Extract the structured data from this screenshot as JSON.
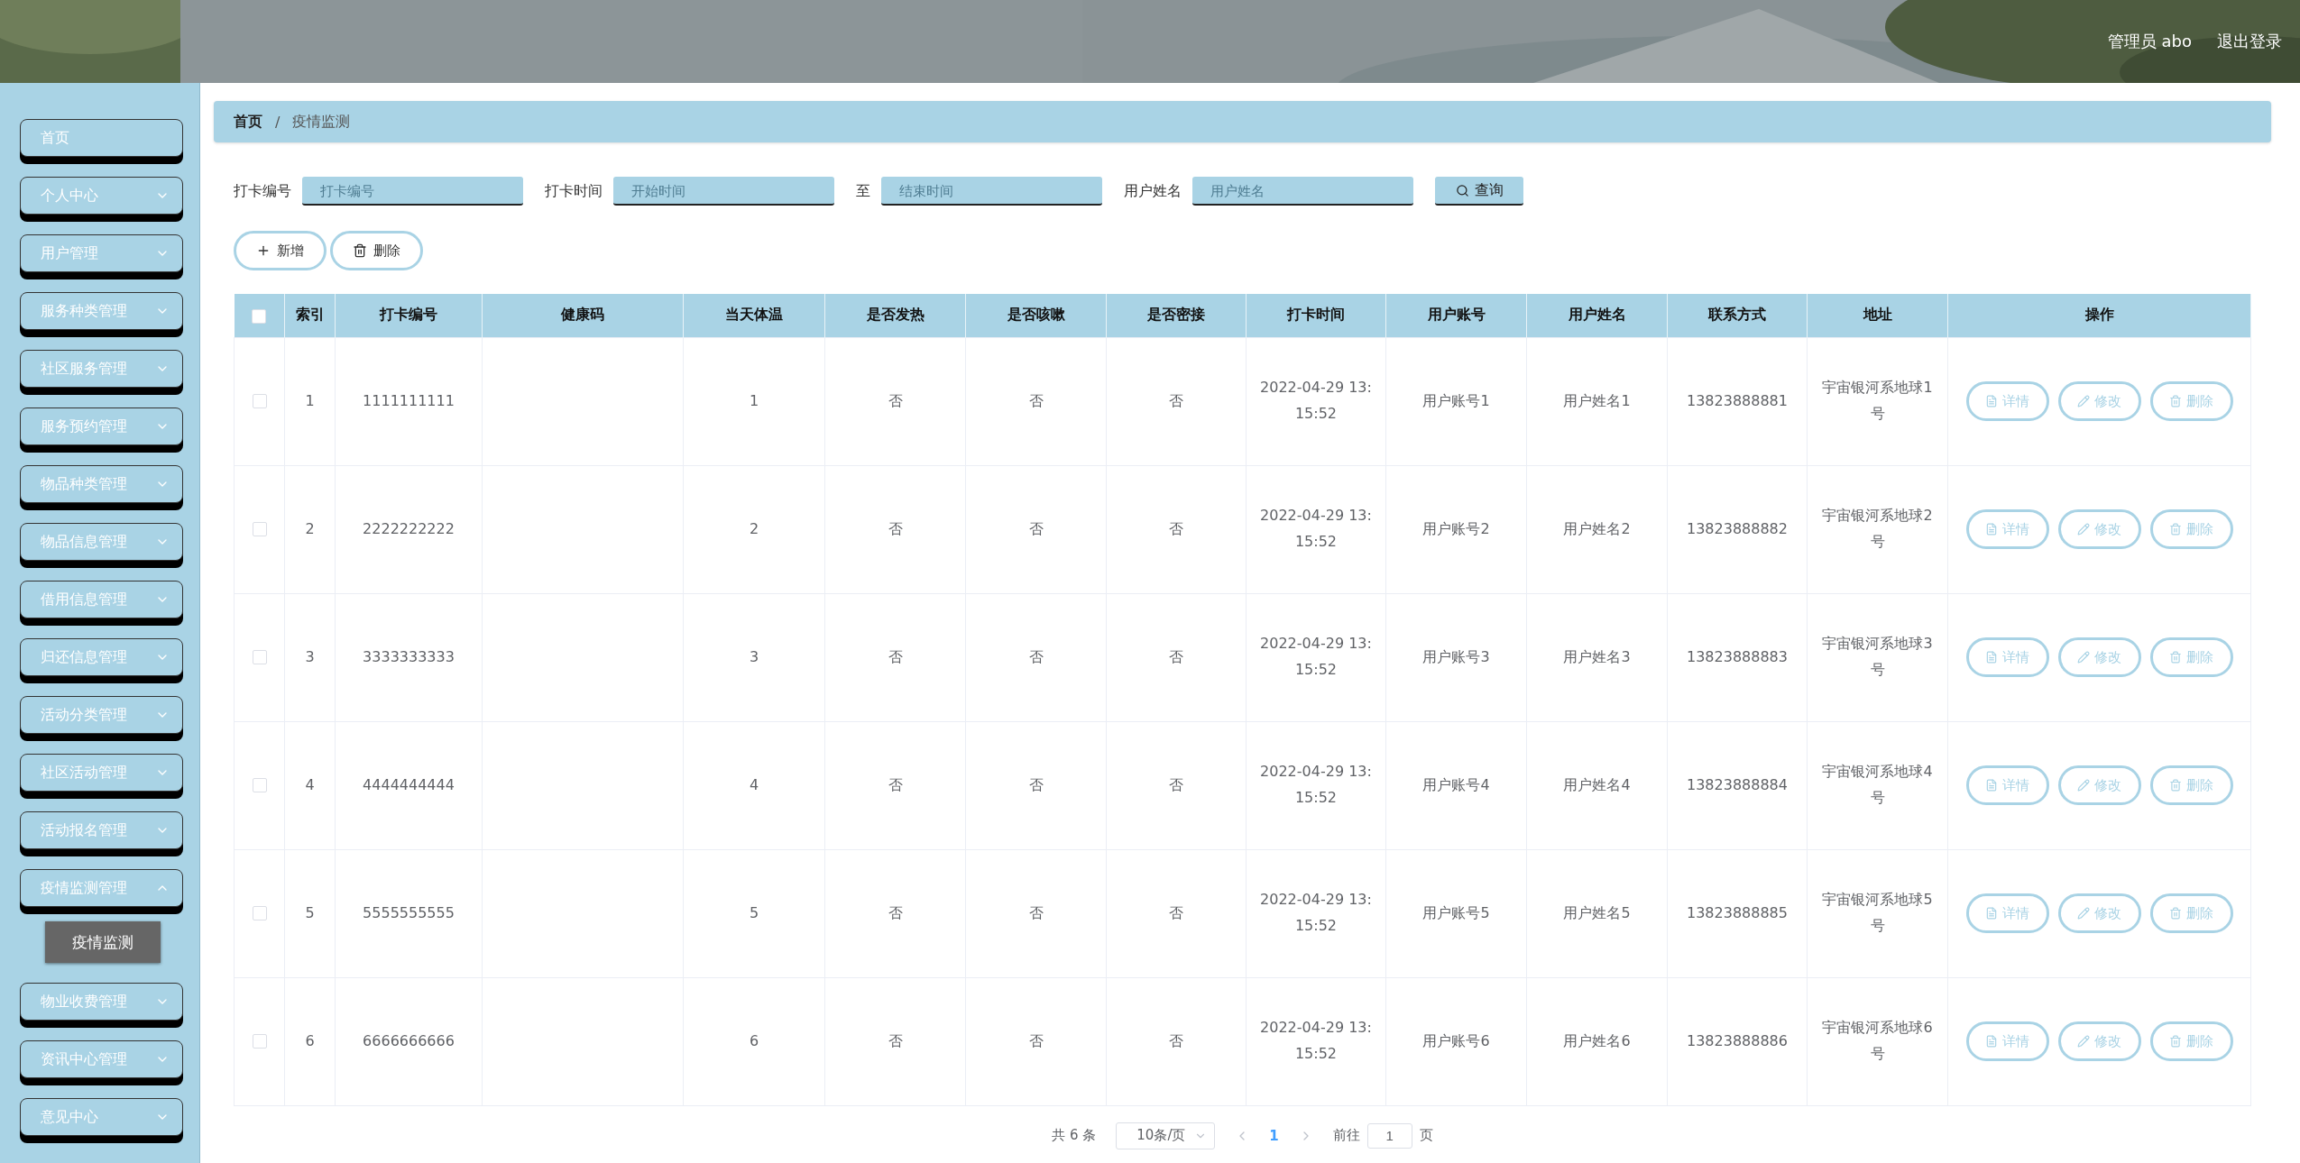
{
  "header": {
    "user": "管理员 abo",
    "logout": "退出登录"
  },
  "sidebar": {
    "items": [
      {
        "label": "首页",
        "kind": "link"
      },
      {
        "label": "个人中心",
        "kind": "menu",
        "expanded": false
      },
      {
        "label": "用户管理",
        "kind": "menu",
        "expanded": false
      },
      {
        "label": "服务种类管理",
        "kind": "menu",
        "expanded": false
      },
      {
        "label": "社区服务管理",
        "kind": "menu",
        "expanded": false
      },
      {
        "label": "服务预约管理",
        "kind": "menu",
        "expanded": false
      },
      {
        "label": "物品种类管理",
        "kind": "menu",
        "expanded": false
      },
      {
        "label": "物品信息管理",
        "kind": "menu",
        "expanded": false
      },
      {
        "label": "借用信息管理",
        "kind": "menu",
        "expanded": false
      },
      {
        "label": "归还信息管理",
        "kind": "menu",
        "expanded": false
      },
      {
        "label": "活动分类管理",
        "kind": "menu",
        "expanded": false
      },
      {
        "label": "社区活动管理",
        "kind": "menu",
        "expanded": false
      },
      {
        "label": "活动报名管理",
        "kind": "menu",
        "expanded": false
      },
      {
        "label": "疫情监测管理",
        "kind": "menu",
        "expanded": true,
        "children": [
          {
            "label": "疫情监测",
            "selected": true
          }
        ]
      },
      {
        "label": "物业收费管理",
        "kind": "menu",
        "expanded": false
      },
      {
        "label": "资讯中心管理",
        "kind": "menu",
        "expanded": false
      },
      {
        "label": "意见中心",
        "kind": "menu",
        "expanded": false
      }
    ]
  },
  "breadcrumb": {
    "separator": "/",
    "items": [
      {
        "label": "首页",
        "current": false
      },
      {
        "label": "疫情监测",
        "current": true
      }
    ]
  },
  "search": {
    "fields": [
      {
        "label": "打卡编号",
        "placeholder": "打卡编号"
      },
      {
        "label": "打卡时间",
        "placeholder": "开始时间"
      },
      {
        "label": "至",
        "placeholder": "结束时间"
      },
      {
        "label": "用户姓名",
        "placeholder": "用户姓名"
      }
    ],
    "button": "查询"
  },
  "actions": [
    {
      "label": "新增",
      "kind": "add"
    },
    {
      "label": "删除",
      "kind": "delete"
    }
  ],
  "table": {
    "select_all_checked": false,
    "columns": [
      "索引",
      "打卡编号",
      "健康码",
      "当天体温",
      "是否发热",
      "是否咳嗽",
      "是否密接",
      "打卡时间",
      "用户账号",
      "用户姓名",
      "联系方式",
      "地址",
      "操作"
    ],
    "rows": [
      {
        "checked": false,
        "cells": [
          "1",
          "1111111111",
          "",
          "1",
          "否",
          "否",
          "否",
          "2022-04-29 13:15:52",
          "用户账号1",
          "用户姓名1",
          "13823888881",
          "宇宙银河系地球1号"
        ],
        "actions": [
          {
            "label": "详情",
            "kind": "detail"
          },
          {
            "label": "修改",
            "kind": "edit"
          },
          {
            "label": "删除",
            "kind": "delete"
          }
        ]
      },
      {
        "checked": false,
        "cells": [
          "2",
          "2222222222",
          "",
          "2",
          "否",
          "否",
          "否",
          "2022-04-29 13:15:52",
          "用户账号2",
          "用户姓名2",
          "13823888882",
          "宇宙银河系地球2号"
        ],
        "actions": [
          {
            "label": "详情",
            "kind": "detail"
          },
          {
            "label": "修改",
            "kind": "edit"
          },
          {
            "label": "删除",
            "kind": "delete"
          }
        ]
      },
      {
        "checked": false,
        "cells": [
          "3",
          "3333333333",
          "",
          "3",
          "否",
          "否",
          "否",
          "2022-04-29 13:15:52",
          "用户账号3",
          "用户姓名3",
          "13823888883",
          "宇宙银河系地球3号"
        ],
        "actions": [
          {
            "label": "详情",
            "kind": "detail"
          },
          {
            "label": "修改",
            "kind": "edit"
          },
          {
            "label": "删除",
            "kind": "delete"
          }
        ]
      },
      {
        "checked": false,
        "cells": [
          "4",
          "4444444444",
          "",
          "4",
          "否",
          "否",
          "否",
          "2022-04-29 13:15:52",
          "用户账号4",
          "用户姓名4",
          "13823888884",
          "宇宙银河系地球4号"
        ],
        "actions": [
          {
            "label": "详情",
            "kind": "detail"
          },
          {
            "label": "修改",
            "kind": "edit"
          },
          {
            "label": "删除",
            "kind": "delete"
          }
        ]
      },
      {
        "checked": false,
        "cells": [
          "5",
          "5555555555",
          "",
          "5",
          "否",
          "否",
          "否",
          "2022-04-29 13:15:52",
          "用户账号5",
          "用户姓名5",
          "13823888885",
          "宇宙银河系地球5号"
        ],
        "actions": [
          {
            "label": "详情",
            "kind": "detail"
          },
          {
            "label": "修改",
            "kind": "edit"
          },
          {
            "label": "删除",
            "kind": "delete"
          }
        ]
      },
      {
        "checked": false,
        "cells": [
          "6",
          "6666666666",
          "",
          "6",
          "否",
          "否",
          "否",
          "2022-04-29 13:15:52",
          "用户账号6",
          "用户姓名6",
          "13823888886",
          "宇宙银河系地球6号"
        ],
        "actions": [
          {
            "label": "详情",
            "kind": "detail"
          },
          {
            "label": "修改",
            "kind": "edit"
          },
          {
            "label": "删除",
            "kind": "delete"
          }
        ]
      }
    ]
  },
  "pagination": {
    "total": "共 6 条",
    "page_size": "10条/页",
    "pages": [
      {
        "label": "1",
        "selected": true
      }
    ],
    "goto_label": "前往",
    "goto_value": "1",
    "goto_suffix": "页"
  }
}
